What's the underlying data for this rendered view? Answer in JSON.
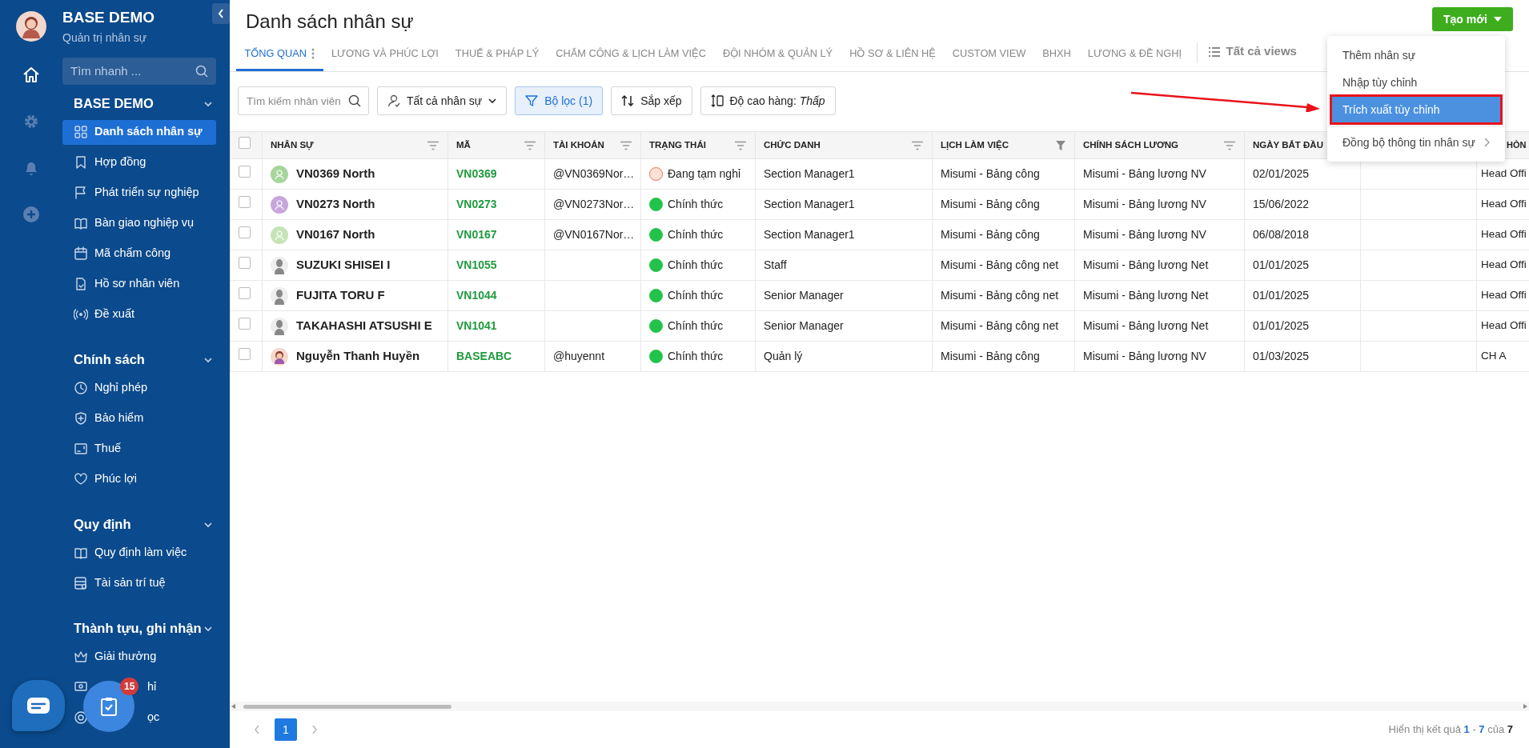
{
  "sidebar": {
    "rail": [
      {
        "selected": true
      },
      {
        "selected": false
      },
      {
        "selected": false
      },
      {
        "selected": false
      }
    ],
    "brand": {
      "title": "BASE DEMO",
      "subtitle": "Quản trị nhân sự"
    },
    "search": {
      "placeholder": "Tìm nhanh ..."
    },
    "sections": [
      {
        "title": "BASE DEMO",
        "expanded": true,
        "items": [
          {
            "label": "Danh sách nhân sự",
            "selected": true,
            "partly_covered": false
          },
          {
            "label": "Hợp đồng",
            "selected": false,
            "partly_covered": false
          },
          {
            "label": "Phát triển sự nghiệp",
            "selected": false,
            "partly_covered": false
          },
          {
            "label": "Bàn giao nghiệp vụ",
            "selected": false,
            "partly_covered": false
          },
          {
            "label": "Mã chấm công",
            "selected": false,
            "partly_covered": false
          },
          {
            "label": "Hồ sơ nhân viên",
            "selected": false,
            "partly_covered": false
          },
          {
            "label": "Đề xuất",
            "selected": false,
            "partly_covered": false
          }
        ]
      },
      {
        "title": "Chính sách",
        "expanded": true,
        "items": [
          {
            "label": "Nghỉ phép",
            "selected": false,
            "partly_covered": false
          },
          {
            "label": "Bảo hiểm",
            "selected": false,
            "partly_covered": false
          },
          {
            "label": "Thuế",
            "selected": false,
            "partly_covered": false
          },
          {
            "label": "Phúc lợi",
            "selected": false,
            "partly_covered": false
          }
        ]
      },
      {
        "title": "Quy định",
        "expanded": true,
        "items": [
          {
            "label": "Quy định làm việc",
            "selected": false,
            "partly_covered": false
          },
          {
            "label": "Tài sản trí tuệ",
            "selected": false,
            "partly_covered": false
          }
        ]
      },
      {
        "title": "Thành tựu, ghi nhận",
        "expanded": true,
        "items": [
          {
            "label": "Giải thưởng",
            "selected": false,
            "partly_covered": false
          },
          {
            "label": "hỉ",
            "selected": false,
            "partly_covered": true
          },
          {
            "label": "ọc",
            "selected": false,
            "partly_covered": true
          }
        ]
      }
    ]
  },
  "floating": {
    "task_badge": "15"
  },
  "page": {
    "title": "Danh sách nhân sự",
    "create_button": "Tạo mới"
  },
  "tabs": [
    {
      "label": "TỔNG QUAN",
      "selected": true
    },
    {
      "label": "LƯƠNG VÀ PHÚC LỢI",
      "selected": false
    },
    {
      "label": "THUẾ & PHÁP LÝ",
      "selected": false
    },
    {
      "label": "CHẤM CÔNG & LỊCH LÀM VIỆC",
      "selected": false
    },
    {
      "label": "ĐỘI NHÓM & QUẢN LÝ",
      "selected": false
    },
    {
      "label": "HỒ SƠ & LIÊN HỆ",
      "selected": false
    },
    {
      "label": "CUSTOM VIEW",
      "selected": false
    },
    {
      "label": "BHXH",
      "selected": false
    },
    {
      "label": "LƯƠNG & ĐỀ NGHỊ",
      "selected": false
    }
  ],
  "all_views": "Tất cả views",
  "create_menu": {
    "items": [
      {
        "label": "Thêm nhân sự",
        "selected": false,
        "marked": false,
        "submenu": false
      },
      {
        "label": "Nhập tùy chỉnh",
        "selected": false,
        "marked": false,
        "submenu": false
      },
      {
        "label": "Trích xuất tùy chỉnh",
        "selected": true,
        "marked": true,
        "submenu": false
      },
      {
        "label": "Đồng bộ thông tin nhân sự",
        "selected": false,
        "marked": false,
        "submenu": true
      }
    ]
  },
  "toolbar": {
    "search_placeholder": "Tìm kiếm nhân viên",
    "scope": "Tất cả nhân sự",
    "filter": {
      "label": "Bộ lọc (1)",
      "active": true
    },
    "sort": "Sắp xếp",
    "row_height": "Độ cao hàng: *Thấp*"
  },
  "table": {
    "select_all": {
      "checked": false
    },
    "columns": [
      {
        "label": "NHÂN SỰ",
        "filtered": false
      },
      {
        "label": "MÃ",
        "filtered": false
      },
      {
        "label": "TÀI KHOẢN",
        "filtered": false
      },
      {
        "label": "TRẠNG THÁI",
        "filtered": false
      },
      {
        "label": "CHỨC DANH",
        "filtered": false
      },
      {
        "label": "LỊCH LÀM VIỆC",
        "filtered": true
      },
      {
        "label": "CHÍNH SÁCH LƯƠNG",
        "filtered": false
      },
      {
        "label": "NGÀY BẮT ĐẦU"
      },
      {},
      {
        "label": "HÒN"
      }
    ],
    "rows": [
      {
        "selected": false,
        "avatar": {
          "kind": "placeholder",
          "color": "#a6d59c"
        },
        "cells": [
          "VN0369 North",
          "VN0369",
          "@VN0369Nor…",
          "Đang tạm nghỉ",
          "Section Manager1",
          "Misumi - Bảng công",
          "Misumi - Bảng lương NV",
          "02/01/2025",
          "",
          "Head Offi"
        ],
        "on_leave": true
      },
      {
        "selected": false,
        "avatar": {
          "kind": "placeholder",
          "color": "#c7a6dc"
        },
        "cells": [
          "VN0273 North",
          "VN0273",
          "@VN0273Nor…",
          "Chính thức",
          "Section Manager1",
          "Misumi - Bảng công",
          "Misumi - Bảng lương NV",
          "15/06/2022",
          "",
          "Head Offi"
        ],
        "on_leave": false
      },
      {
        "selected": false,
        "avatar": {
          "kind": "placeholder",
          "color": "#c5e4b6"
        },
        "cells": [
          "VN0167 North",
          "VN0167",
          "@VN0167Nor…",
          "Chính thức",
          "Section Manager1",
          "Misumi - Bảng công",
          "Misumi - Bảng lương NV",
          "06/08/2018",
          "",
          "Head Offi"
        ],
        "on_leave": false
      },
      {
        "selected": false,
        "avatar": {
          "kind": "silhouette"
        },
        "cells": [
          "SUZUKI SHISEI I",
          "VN1055",
          "",
          "Chính thức",
          "Staff",
          "Misumi - Bảng công net",
          "Misumi - Bảng lương Net",
          "01/01/2025",
          "",
          "Head Offi"
        ],
        "on_leave": false
      },
      {
        "selected": false,
        "avatar": {
          "kind": "silhouette"
        },
        "cells": [
          "FUJITA TORU F",
          "VN1044",
          "",
          "Chính thức",
          "Senior Manager",
          "Misumi - Bảng công net",
          "Misumi - Bảng lương Net",
          "01/01/2025",
          "",
          "Head Offi"
        ],
        "on_leave": false
      },
      {
        "selected": false,
        "avatar": {
          "kind": "silhouette"
        },
        "cells": [
          "TAKAHASHI ATSUSHI E",
          "VN1041",
          "",
          "Chính thức",
          "Senior Manager",
          "Misumi - Bảng công net",
          "Misumi - Bảng lương Net",
          "01/01/2025",
          "",
          "Head Offi"
        ],
        "on_leave": false
      },
      {
        "selected": false,
        "cells": [
          "Nguyễn Thanh Huyền",
          "BASEABC",
          "@huyennt",
          "Chính thức",
          "Quản lý",
          "Misumi - Bảng công",
          "Misumi - Bảng lương NV",
          "01/03/2025",
          "",
          "CH A"
        ],
        "on_leave": false
      }
    ]
  },
  "pagination": {
    "pages": [
      {
        "label": "1",
        "selected": true
      }
    ],
    "summary": "Hiển thị kết quả **1** - **7** của **7**"
  }
}
